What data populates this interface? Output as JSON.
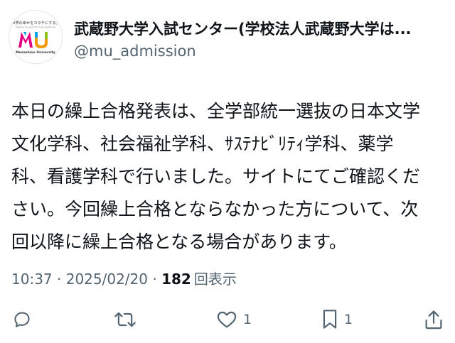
{
  "author": {
    "display_name": "武蔵野大学入試センター(学校法人武蔵野大学は...",
    "handle": "@mu_admission",
    "avatar": {
      "tagline": "世界の幸せをカタチにする。",
      "subtagline": "Shaping the world through happiness",
      "logo_text": "MU",
      "university_name": "Musashino University",
      "colors": [
        "#e4007f",
        "#00a0e9",
        "#f39800",
        "#8fc31f"
      ]
    }
  },
  "post": {
    "lines": [
      "本日の繰上合格発表は、全学部統一選抜の日本文学",
      "文化学科、社会福祉学科、ｻｽﾃﾅﾋﾞﾘﾃｨ学科、薬学",
      "科、看護学科で行いました。サイトにてご確認くだ",
      "さい。今回繰上合格とならなかった方について、次",
      "回以降に繰上合格となる場合があります。"
    ]
  },
  "meta": {
    "time": "10:37",
    "separator": " · ",
    "date": "2025/02/20",
    "views_count": "182",
    "views_label": "回表示"
  },
  "actions": {
    "reply": {
      "icon": "reply-icon",
      "count": ""
    },
    "repost": {
      "icon": "repost-icon",
      "count": ""
    },
    "like": {
      "icon": "heart-icon",
      "count": "1"
    },
    "bookmark": {
      "icon": "bookmark-icon",
      "count": "1"
    },
    "share": {
      "icon": "share-icon",
      "count": ""
    }
  },
  "colors": {
    "text_primary": "#0f1419",
    "text_secondary": "#536471",
    "background": "#ffffff"
  }
}
